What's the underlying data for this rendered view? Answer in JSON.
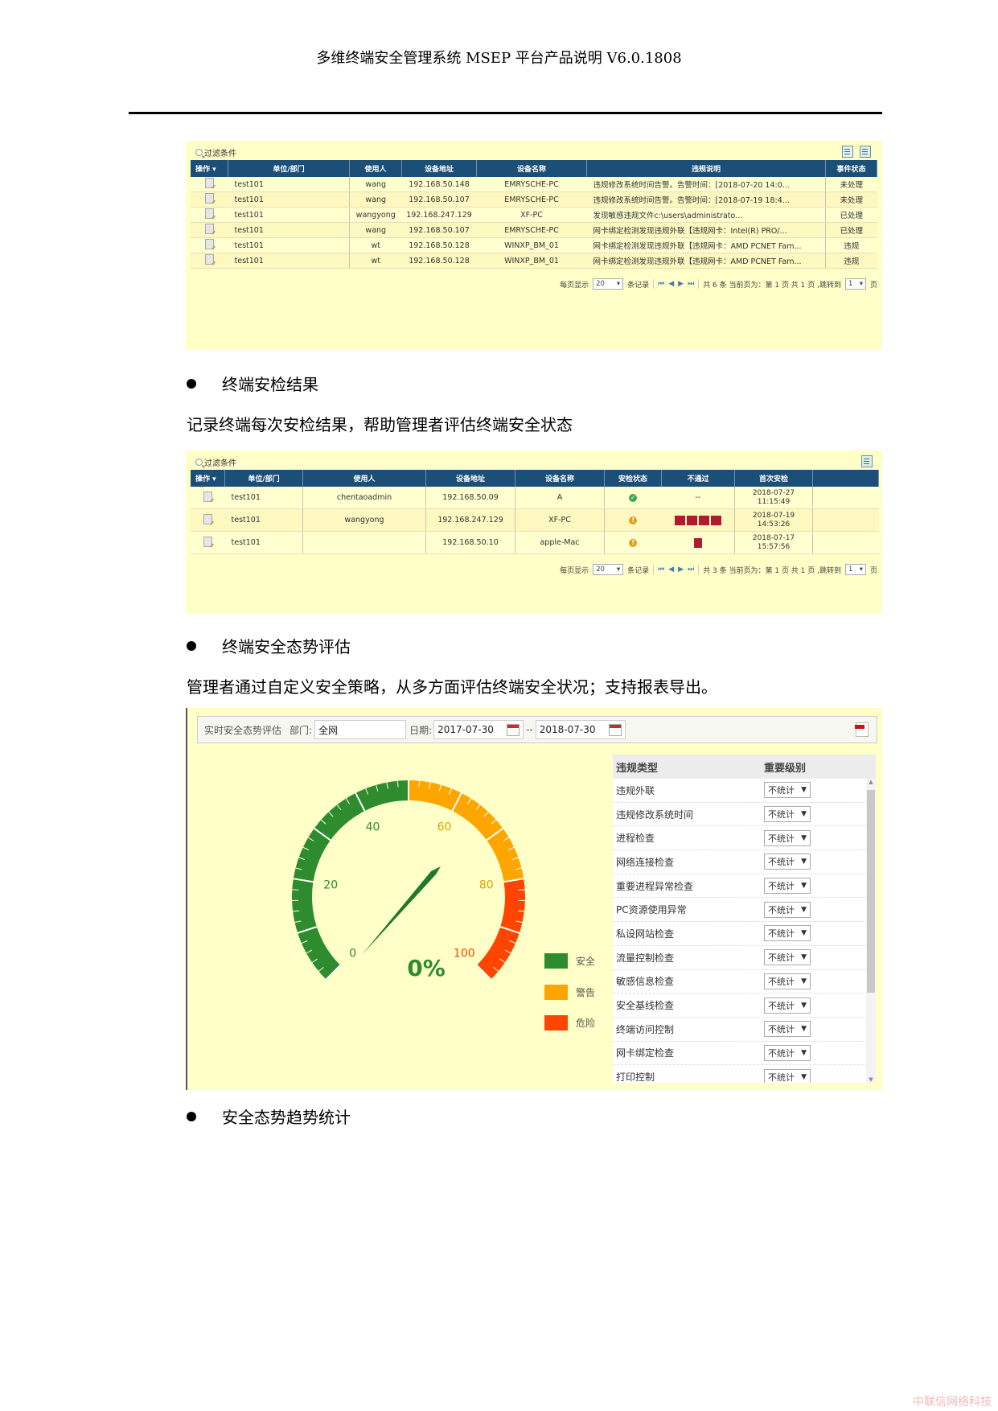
{
  "header": {
    "title": "多维终端安全管理系统 MSEP 平台产品说明 V6.0.1808"
  },
  "panel1": {
    "filter_label": "过滤条件",
    "toolbar_icons": [
      "export-icon",
      "export-excel-icon"
    ],
    "columns": [
      "操作",
      "单位/部门",
      "使用人",
      "设备地址",
      "设备名称",
      "违规说明",
      "事件状态"
    ],
    "rows": [
      {
        "dept": "test101",
        "user": "wang",
        "ip": "192.168.50.148",
        "device": "EMRYSCHE-PC",
        "desc": "违规修改系统时间告警。告警时间：[2018-07-20 14:0...",
        "status": "未处理",
        "status_red": true
      },
      {
        "dept": "test101",
        "user": "wang",
        "ip": "192.168.50.107",
        "device": "EMRYSCHE-PC",
        "desc": "违规修改系统时间告警。告警时间：[2018-07-19 18:4...",
        "status": "未处理",
        "status_red": true
      },
      {
        "dept": "test101",
        "user": "wangyong",
        "ip": "192.168.247.129",
        "device": "XF-PC",
        "desc": "发现敏感违规文件c:\\users\\administrato...",
        "status": "已处理",
        "status_red": false
      },
      {
        "dept": "test101",
        "user": "wang",
        "ip": "192.168.50.107",
        "device": "EMRYSCHE-PC",
        "desc": "网卡绑定检测发现违规外联【违规网卡：Intel(R) PRO/...",
        "status": "已处理",
        "status_red": false
      },
      {
        "dept": "test101",
        "user": "wt",
        "ip": "192.168.50.128",
        "device": "WINXP_BM_01",
        "desc": "网卡绑定检测发现违规外联【违规网卡：AMD PCNET Fam...",
        "status": "违规",
        "status_red": true
      },
      {
        "dept": "test101",
        "user": "wt",
        "ip": "192.168.50.128",
        "device": "WINXP_BM_01",
        "desc": "网卡绑定检测发现违规外联【违规网卡：AMD PCNET Fam...",
        "status": "违规",
        "status_red": true
      }
    ],
    "pager": {
      "per_page_label": "每页显示",
      "per_page": "20",
      "records_label": "条记录",
      "summary": "共 6 条 当前页为：第 1 页 共 1 页 ,跳转到",
      "page": "1",
      "page_suffix": "页"
    }
  },
  "section1": {
    "bullet": "终端安检结果",
    "para": "记录终端每次安检结果，帮助管理者评估终端安全状态"
  },
  "panel2": {
    "filter_label": "过滤条件",
    "columns": [
      "操作",
      "单位/部门",
      "使用人",
      "设备地址",
      "设备名称",
      "安检状态",
      "不通过",
      "首次安检",
      ""
    ],
    "rows": [
      {
        "dept": "test101",
        "user": "chentaoadmin",
        "ip": "192.168.50.09",
        "device": "A",
        "status": "pass",
        "fail": "--",
        "date": "2018-07-27",
        "time": "11:15:49"
      },
      {
        "dept": "test101",
        "user": "wangyong",
        "ip": "192.168.247.129",
        "device": "XF-PC",
        "status": "warn",
        "fail_icons": [
          "shield-icon",
          "user-icon",
          "network-icon",
          "key-icon"
        ],
        "date": "2018-07-19",
        "time": "14:53:26"
      },
      {
        "dept": "test101",
        "user": "",
        "ip": "192.168.50.10",
        "device": "apple-Mac",
        "status": "warn",
        "fail_icons": [
          "disk-icon"
        ],
        "date": "2018-07-17",
        "time": "15:57:56"
      }
    ],
    "pager": {
      "per_page_label": "每页显示",
      "per_page": "20",
      "records_label": "条记录",
      "summary": "共 3 条 当前页为：第 1 页 共 1 页 ,跳转到",
      "page": "1",
      "page_suffix": "页"
    }
  },
  "section2": {
    "bullet": "终端安全态势评估",
    "para": "管理者通过自定义安全策略，从多方面评估终端安全状况；支持报表导出。"
  },
  "panel3": {
    "title": "实时安全态势评估",
    "dept_label": "部门:",
    "dept_value": "全网",
    "date_label": "日期:",
    "date_from": "2017-07-30",
    "date_sep": "--",
    "date_to": "2018-07-30",
    "gauge": {
      "value_percent": 0,
      "display": "0%",
      "ticks": [
        "0",
        "20",
        "40",
        "60",
        "80",
        "100"
      ],
      "bands": [
        {
          "from": 0,
          "to": 50,
          "color": "#2e8b2e"
        },
        {
          "from": 50,
          "to": 80,
          "color": "#ffa500"
        },
        {
          "from": 80,
          "to": 100,
          "color": "#ff4500"
        }
      ]
    },
    "legend": [
      {
        "label": "安全",
        "color": "#2e8b2e"
      },
      {
        "label": "警告",
        "color": "#ffa500"
      },
      {
        "label": "危险",
        "color": "#ff4500"
      }
    ],
    "table_headers": [
      "违规类型",
      "重要级别"
    ],
    "violations": [
      {
        "type": "违规外联",
        "level": "不统计"
      },
      {
        "type": "违规修改系统时间",
        "level": "不统计"
      },
      {
        "type": "进程检查",
        "level": "不统计"
      },
      {
        "type": "网络连接检查",
        "level": "不统计"
      },
      {
        "type": "重要进程异常检查",
        "level": "不统计"
      },
      {
        "type": "PC资源使用异常",
        "level": "不统计"
      },
      {
        "type": "私设网站检查",
        "level": "不统计"
      },
      {
        "type": "流量控制检查",
        "level": "不统计"
      },
      {
        "type": "敏感信息检查",
        "level": "不统计"
      },
      {
        "type": "安全基线检查",
        "level": "不统计"
      },
      {
        "type": "终端访问控制",
        "level": "不统计"
      },
      {
        "type": "网卡绑定检查",
        "level": "不统计"
      },
      {
        "type": "打印控制",
        "level": "不统计"
      }
    ]
  },
  "section3": {
    "bullet": "安全态势趋势统计"
  },
  "watermark": "中联信网络科技"
}
